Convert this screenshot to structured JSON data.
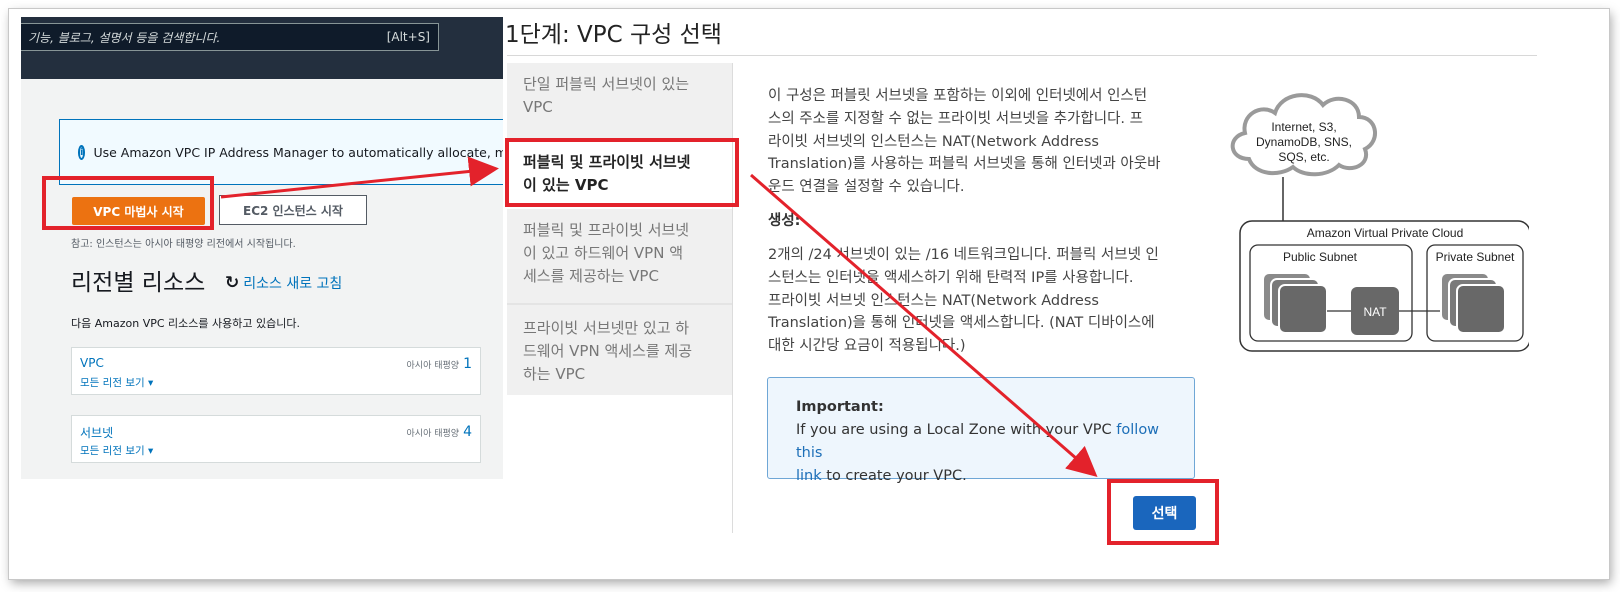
{
  "aws_console": {
    "search_placeholder": "기능, 블로그, 설명서 등을 검색합니다.",
    "search_shortcut": "[Alt+S]",
    "info_banner": "Use Amazon VPC IP Address Manager to automatically allocate, mana",
    "wizard_button": "VPC 마법사 시작",
    "ec2_button": "EC2 인스턴스 시작",
    "note": "참고: 인스턴스는 아시아 태평양 리전에서 시작됩니다.",
    "section_title": "리전별 리소스",
    "refresh_link": "리소스 새로 고침",
    "section_desc": "다음 Amazon VPC 리소스를 사용하고 있습니다.",
    "cards": [
      {
        "title": "VPC",
        "link": "모든 리전 보기 ▾",
        "region": "아시아 태평양",
        "count": "1"
      },
      {
        "title": "서브넷",
        "link": "모든 리전 보기 ▾",
        "region": "아시아 태평양",
        "count": "4"
      }
    ]
  },
  "wizard": {
    "title": "1단계: VPC 구성 선택",
    "options": [
      {
        "lines": [
          "단일 퍼블릭 서브넷이 있는",
          "VPC"
        ]
      },
      {
        "lines": [
          "퍼블릭 및 프라이빗 서브넷",
          "이 있는 VPC"
        ]
      },
      {
        "lines": [
          "퍼블릭 및 프라이빗 서브넷",
          "이 있고 하드웨어 VPN 액",
          "세스를 제공하는 VPC"
        ]
      },
      {
        "lines": [
          "프라이빗 서브넷만 있고 하",
          "드웨어 VPN 액세스를 제공",
          "하는 VPC"
        ]
      }
    ],
    "description_lines": [
      "이 구성은 퍼블릿 서브넷을 포함하는 이외에 인터넷에서 인스턴",
      "스의 주소를 지정할 수 없는 프라이빗 서브넷을 추가합니다. 프",
      "라이빗 서브넷의 인스턴스는 NAT(Network Address",
      "Translation)를 사용하는 퍼블릭 서브넷을 통해 인터넷과 아웃바",
      "운드 연결을 설정할 수 있습니다."
    ],
    "creates_heading": "생성:",
    "creates_lines": [
      "2개의 /24 서브넷이 있는 /16 네트워크입니다. 퍼블릭 서브넷 인",
      "스턴스는 인터넷을 액세스하기 위해 탄력적 IP를 사용합니다.",
      "프라이빗 서브넷 인스턴스는 NAT(Network Address",
      "Translation)을 통해 인터넷을 액세스합니다. (NAT 디바이스에",
      "대한 시간당 요금이 적용됩니다.)"
    ],
    "important": {
      "title": "Important:",
      "text_before": "If you are using a Local Zone with your VPC ",
      "link_part1": "follow this",
      "link_part2": "link",
      "text_after": " to create your VPC."
    },
    "select_button": "선택",
    "diagram": {
      "cloud_lines": [
        "Internet, S3,",
        "DynamoDB, SNS,",
        "SQS, etc."
      ],
      "vpc_label": "Amazon Virtual Private Cloud",
      "public_subnet": "Public Subnet",
      "private_subnet": "Private Subnet",
      "nat": "NAT"
    }
  },
  "colors": {
    "annotation_red": "#e3222b",
    "aws_orange": "#ec7211",
    "aws_blue": "#0073bb",
    "select_blue": "#1a66bd"
  }
}
